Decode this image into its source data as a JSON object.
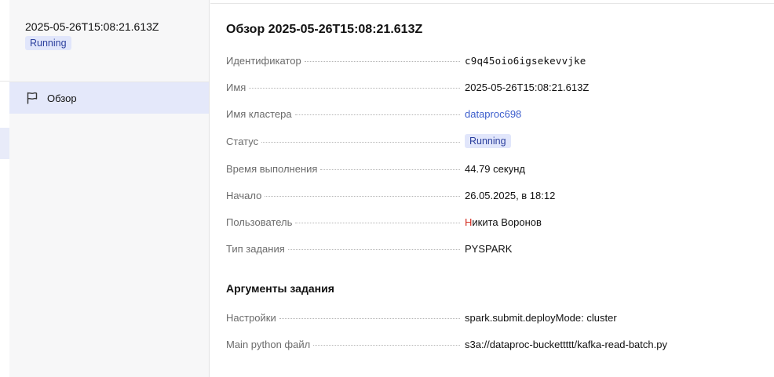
{
  "sidebar": {
    "title": "2025-05-26T15:08:21.613Z",
    "status_badge": "Running",
    "nav": [
      {
        "label": "Обзор",
        "icon": "flag-icon"
      }
    ]
  },
  "main": {
    "title": "Обзор 2025-05-26T15:08:21.613Z",
    "fields": {
      "id": {
        "label": "Идентификатор",
        "value": "c9q45oio6igsekevvjke"
      },
      "name": {
        "label": "Имя",
        "value": "2025-05-26T15:08:21.613Z"
      },
      "cluster": {
        "label": "Имя кластера",
        "value": "dataproc698"
      },
      "status": {
        "label": "Статус",
        "value": "Running"
      },
      "duration": {
        "label": "Время выполнения",
        "value": "44.79 секунд"
      },
      "start": {
        "label": "Начало",
        "value": "26.05.2025, в 18:12"
      },
      "user": {
        "label": "Пользователь",
        "value_first": "Н",
        "value_rest": "икита Воронов"
      },
      "job_type": {
        "label": "Тип задания",
        "value": "PYSPARK"
      }
    },
    "args_section": {
      "title": "Аргументы задания",
      "settings": {
        "label": "Настройки",
        "value": "spark.submit.deployMode: cluster"
      },
      "main_file": {
        "label": "Main python файл",
        "value": "s3a://dataproc-buckettttt/kafka-read-batch.py"
      }
    }
  },
  "colors": {
    "badge_bg": "#e1e6fb",
    "badge_text": "#2b3f9d",
    "link": "#3a5ccc",
    "nav_active_bg": "#e4e8fa"
  }
}
